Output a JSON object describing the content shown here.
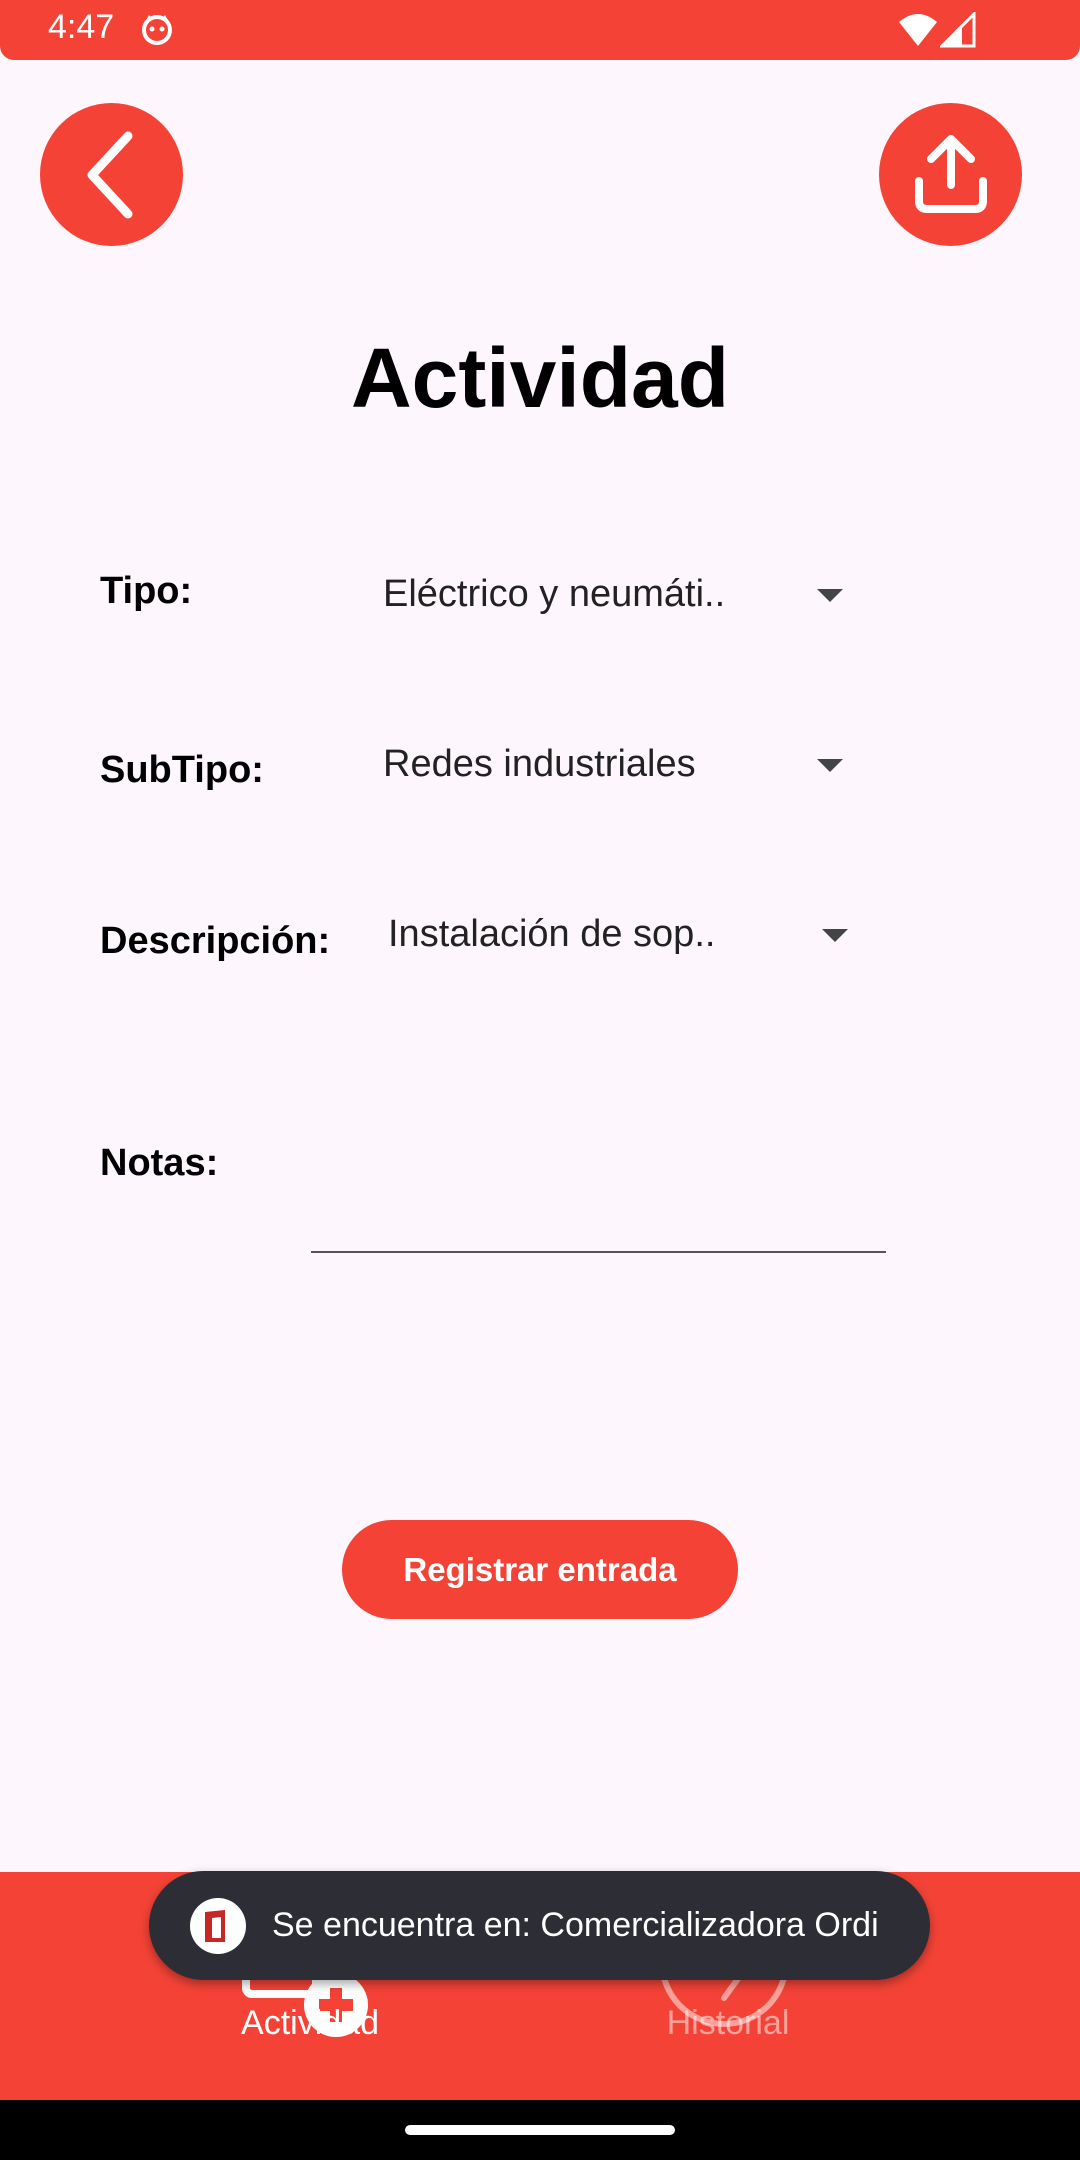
{
  "status_bar": {
    "time": "4:47"
  },
  "header": {
    "title": "Actividad"
  },
  "form": {
    "tipo": {
      "label": "Tipo:",
      "value": "Eléctrico y neumáti.."
    },
    "subtipo": {
      "label": "SubTipo:",
      "value": "Redes industriales"
    },
    "descripcion": {
      "label": "Descripción:",
      "value": "Instalación de sop.."
    },
    "notas": {
      "label": "Notas:",
      "value": ""
    },
    "submit_label": "Registrar entrada"
  },
  "bottom_nav": {
    "items": [
      {
        "label": "Actividad",
        "icon": "add-activity-icon",
        "active": true
      },
      {
        "label": "Historial",
        "icon": "history-icon",
        "active": false
      }
    ]
  },
  "toast": {
    "text": "Se encuentra en: Comercializadora Ordi"
  },
  "colors": {
    "accent": "#f44336",
    "background": "#fdf7fd",
    "toast": "#2d2d35"
  }
}
